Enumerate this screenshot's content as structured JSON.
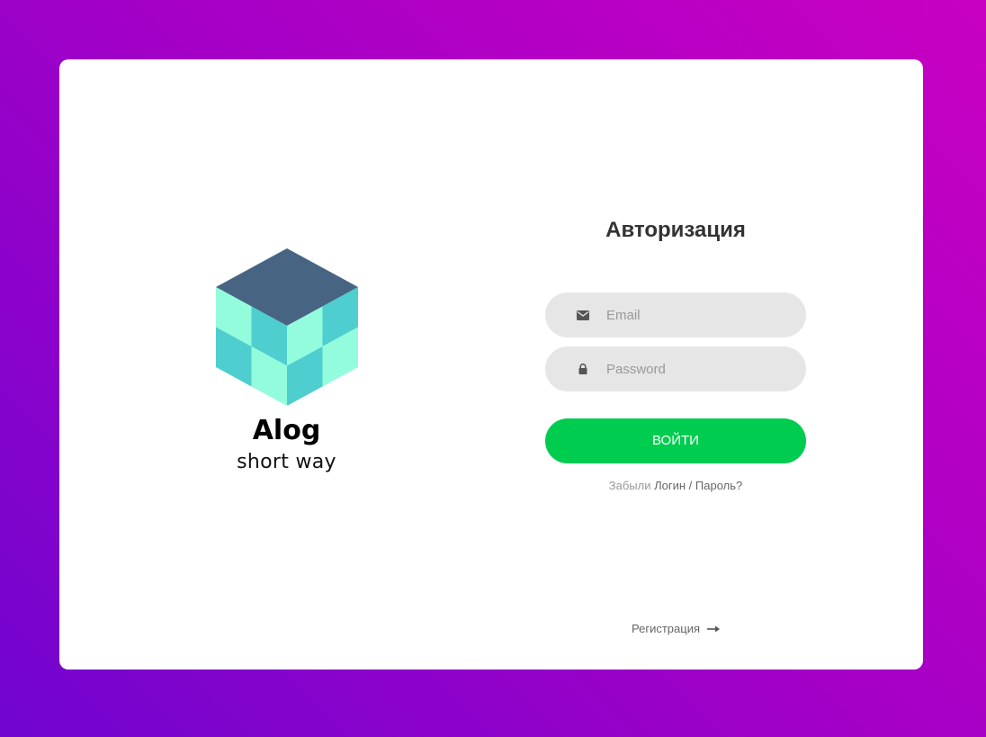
{
  "brand": {
    "name": "Alog",
    "tagline": "short way",
    "colors": {
      "top": "#476583",
      "light": "#93fcdc",
      "teal": "#4ecece"
    }
  },
  "login": {
    "title": "Авторизация",
    "email": {
      "placeholder": "Email",
      "value": "",
      "icon": "envelope-icon"
    },
    "password": {
      "placeholder": "Password",
      "value": "",
      "icon": "lock-icon"
    },
    "submit_label": "ВОЙТИ",
    "forgot_prefix": "Забыли",
    "forgot_link_login": "Логин",
    "forgot_separator": " / ",
    "forgot_link_password": "Пароль?",
    "register_label": "Регистрация",
    "register_icon": "arrow-right-icon"
  },
  "colors": {
    "accent_button": "#00cc4f",
    "background_gradient_start": "#7005cf",
    "background_gradient_end": "#c800c2",
    "field_background": "#e6e6e6"
  }
}
